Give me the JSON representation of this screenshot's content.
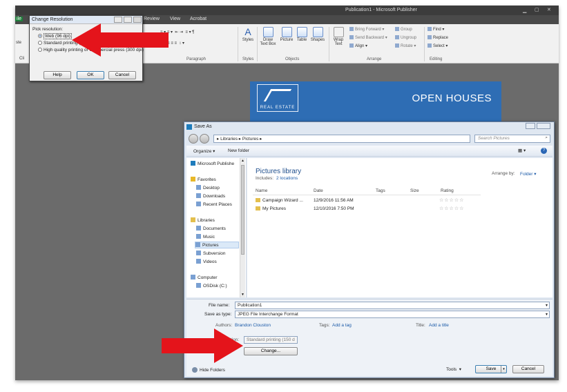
{
  "app": {
    "window_title": "Publication1 - Microsoft Publisher",
    "menu_tabs": [
      "Review",
      "View",
      "Acrobat"
    ],
    "file_tab": "ile",
    "left_stub_labels": [
      "ste",
      "Cli"
    ]
  },
  "ribbon": {
    "groups": {
      "paragraph": "Paragraph",
      "styles": "Styles",
      "objects": "Objects",
      "arrange": "Arrange",
      "editing": "Editing"
    },
    "buttons": {
      "styles": "Styles",
      "draw_text_box": "Draw Text Box",
      "picture": "Picture",
      "table": "Table",
      "shapes": "Shapes",
      "wrap_text": "Wrap Text",
      "bring_forward": "Bring Forward",
      "send_backward": "Send Backward",
      "align": "Align",
      "group": "Group",
      "ungroup": "Ungroup",
      "rotate": "Rotate",
      "find": "Find",
      "replace": "Replace",
      "select": "Select"
    }
  },
  "publication": {
    "logo_text": "REAL ESTATE",
    "heading": "OPEN HOUSES"
  },
  "change_resolution": {
    "title": "Change Resolution",
    "prompt": "Pick resolution:",
    "options": [
      {
        "label": "Web (96 dpi)",
        "selected": true
      },
      {
        "label": "Standard printing (150 dpi)",
        "selected": false
      },
      {
        "label": "High quality printing or commercial press (300 dpi)",
        "selected": false
      }
    ],
    "visible_text": {
      "opt1": "Web (96 dpi)",
      "opt2": "Standard printing (150 dpi)",
      "opt3": "High quality printing or commercial press (300 dpi)"
    },
    "buttons": {
      "help": "Help",
      "ok": "OK",
      "cancel": "Cancel"
    }
  },
  "save_as": {
    "title": "Save As",
    "address": [
      "Libraries",
      "Pictures"
    ],
    "address_text": "▸ Libraries ▸ Pictures ▸",
    "search_placeholder": "Search Pictures",
    "toolbar": {
      "organize": "Organize ▾",
      "new_folder": "New folder"
    },
    "nav": {
      "publisher": "Microsoft Publishe",
      "favorites": "Favorites",
      "desktop": "Desktop",
      "downloads": "Downloads",
      "recent": "Recent Places",
      "libraries": "Libraries",
      "documents": "Documents",
      "music": "Music",
      "pictures": "Pictures",
      "subversion": "Subversion",
      "videos": "Videos",
      "computer": "Computer",
      "osdisk": "OSDisk (C:)"
    },
    "library_title": "Pictures library",
    "includes_label": "Includes:",
    "includes_link": "2 locations",
    "arrange_by_label": "Arrange by:",
    "arrange_by_value": "Folder ▾",
    "columns": {
      "name": "Name",
      "date": "Date",
      "tags": "Tags",
      "size": "Size",
      "rating": "Rating"
    },
    "rows": [
      {
        "name": "Campaign Wizard ...",
        "date": "12/9/2016 11:56 AM",
        "rating": "☆☆☆☆☆"
      },
      {
        "name": "My Pictures",
        "date": "12/10/2016 7:50 PM",
        "rating": "☆☆☆☆☆"
      }
    ],
    "file_name_label": "File name:",
    "file_name_value": "Publication1",
    "save_type_label": "Save as type:",
    "save_type_value": "JPEG File Interchange Format",
    "authors_label": "Authors:",
    "authors_value": "Brandon Clouston",
    "tags_label": "Tags:",
    "tags_value": "Add a tag",
    "title_label": "Title:",
    "title_value": "Add a title",
    "resolution_label": "solution:",
    "resolution_value": "Standard printing (150 d",
    "change_button": "Change...",
    "hide_folders": "Hide Folders",
    "tools": "Tools",
    "save": "Save",
    "cancel": "Cancel"
  },
  "colors": {
    "arrow": "#e4141b",
    "accent": "#2e6db4",
    "link": "#1b5aa8"
  }
}
